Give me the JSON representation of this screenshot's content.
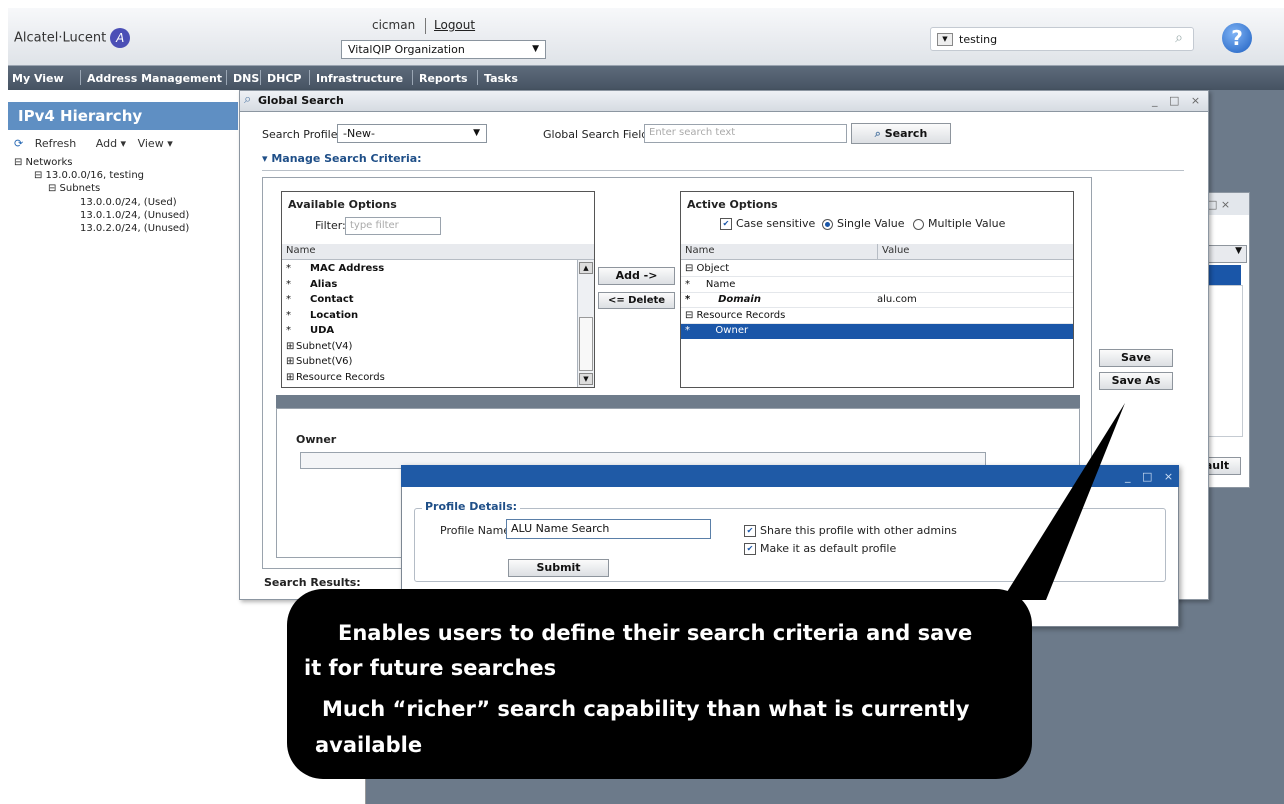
{
  "header": {
    "logo": "Alcatel·Lucent",
    "user": "cicman",
    "logout": "Logout",
    "organization": "VitalQIP Organization",
    "search_value": "testing",
    "help": "?"
  },
  "menu": [
    "My View",
    "Address Management",
    "DNS",
    "DHCP",
    "Infrastructure",
    "Reports",
    "Tasks"
  ],
  "left_panel": {
    "title": "IPv4 Hierarchy",
    "toolbar": {
      "refresh": "Refresh",
      "add": "Add ▾",
      "view": "View ▾"
    },
    "tree": [
      "⊟ Networks",
      "⊟ 13.0.0.0/16, testing",
      "⊟ Subnets",
      "13.0.0.0/24, (Used)",
      "13.0.1.0/24, (Unused)",
      "13.0.2.0/24, (Unused)"
    ]
  },
  "global_search": {
    "title": "Global Search",
    "window_controls": "_ □ ×",
    "search_profile_label": "Search Profile:",
    "search_profile_value": "-New-",
    "global_field_label": "Global Search Field:",
    "global_field_placeholder": "Enter search text",
    "search_button": "Search",
    "manage_label": "▾ Manage Search Criteria:",
    "available": {
      "title": "Available Options",
      "filter_label": "Filter:",
      "filter_placeholder": "type filter",
      "column": "Name",
      "rows": [
        {
          "mark": "*",
          "label": "MAC Address"
        },
        {
          "mark": "*",
          "label": "Alias"
        },
        {
          "mark": "*",
          "label": "Contact"
        },
        {
          "mark": "*",
          "label": "Location"
        },
        {
          "mark": "*",
          "label": "UDA"
        },
        {
          "mark": "⊞",
          "label": "Subnet(V4)"
        },
        {
          "mark": "⊞",
          "label": "Subnet(V6)"
        },
        {
          "mark": "⊞",
          "label": "Resource Records"
        }
      ]
    },
    "add_button": "Add ->",
    "delete_button": "<= Delete",
    "active": {
      "title": "Active Options",
      "case_sensitive": "Case sensitive",
      "single_value": "Single Value",
      "multiple_value": "Multiple Value",
      "col_name": "Name",
      "col_value": "Value",
      "rows": [
        {
          "name": "⊟ Object",
          "value": ""
        },
        {
          "name": "*     Name",
          "value": ""
        },
        {
          "name": "*        Domain",
          "value": "alu.com"
        },
        {
          "name": "⊟ Resource Records",
          "value": ""
        },
        {
          "name": "*        Owner",
          "value": ""
        }
      ]
    },
    "save_button": "Save",
    "save_as_button": "Save As",
    "owner_label": "Owner",
    "search_results_label": "Search Results:"
  },
  "background_window": {
    "controls": "□ ×",
    "button": "ault"
  },
  "profile_dialog": {
    "controls": "_ □ ×",
    "section": "Profile Details:",
    "name_label": "Profile Name:",
    "name_value": "ALU Name Search",
    "share_label": "Share this profile with other admins",
    "default_label": "Make it as default profile",
    "submit": "Submit"
  },
  "callout": {
    "line1": "Enables users to define their search criteria and save",
    "line2": "it for future searches",
    "line3": "Much “richer” search capability than what is currently",
    "line4": "available"
  }
}
